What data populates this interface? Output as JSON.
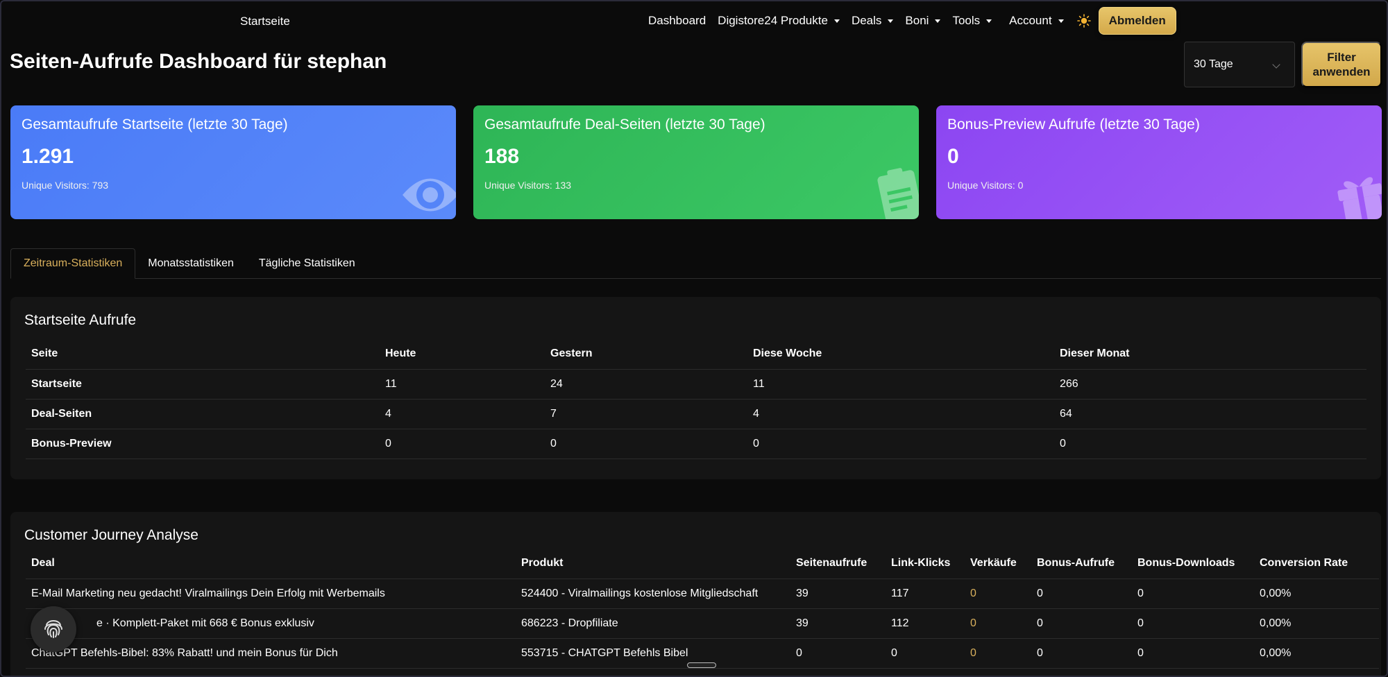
{
  "nav": {
    "brand": "Startseite",
    "items": [
      {
        "label": "Dashboard",
        "dropdown": false
      },
      {
        "label": "Digistore24 Produkte",
        "dropdown": true
      },
      {
        "label": "Deals",
        "dropdown": true
      },
      {
        "label": "Boni",
        "dropdown": true
      },
      {
        "label": "Tools",
        "dropdown": true
      }
    ],
    "account_label": "Account",
    "logout_label": "Abmelden",
    "theme_icon": "sun-icon"
  },
  "header": {
    "title": "Seiten-Aufrufe Dashboard für stephan",
    "period_selected": "30 Tage",
    "filter_label_line1": "Filter",
    "filter_label_line2": "anwenden"
  },
  "cards": [
    {
      "title": "Gesamtaufrufe Startseite (letzte 30 Tage)",
      "value": "1.291",
      "sub": "Unique Visitors: 793",
      "color": "#4a7bf7",
      "icon": "eye-icon"
    },
    {
      "title": "Gesamtaufrufe Deal-Seiten (letzte 30 Tage)",
      "value": "188",
      "sub": "Unique Visitors: 133",
      "color": "#2eb556",
      "icon": "clipboard-icon"
    },
    {
      "title": "Bonus-Preview Aufrufe (letzte 30 Tage)",
      "value": "0",
      "sub": "Unique Visitors: 0",
      "color": "#8c46f2",
      "icon": "gift-icon"
    }
  ],
  "tabs": [
    "Zeitraum-Statistiken",
    "Monatsstatistiken",
    "Tägliche Statistiken"
  ],
  "startseite": {
    "title": "Startseite Aufrufe",
    "columns": [
      "Seite",
      "Heute",
      "Gestern",
      "Diese Woche",
      "Dieser Monat"
    ],
    "rows": [
      [
        "Startseite",
        "11",
        "24",
        "11",
        "266"
      ],
      [
        "Deal-Seiten",
        "4",
        "7",
        "4",
        "64"
      ],
      [
        "Bonus-Preview",
        "0",
        "0",
        "0",
        "0"
      ]
    ]
  },
  "journey": {
    "title": "Customer Journey Analyse",
    "columns": [
      "Deal",
      "Produkt",
      "Seitenaufrufe",
      "Link-Klicks",
      "Verkäufe",
      "Bonus-Aufrufe",
      "Bonus-Downloads",
      "Conversion Rate"
    ],
    "rows": [
      [
        "E-Mail Marketing neu gedacht! Viralmailings Dein Erfolg mit Werbemails",
        "524400 - Viralmailings kostenlose Mitgliedschaft",
        "39",
        "117",
        "0",
        "0",
        "0",
        "0,00%"
      ],
      [
        "e · Komplett-Paket mit 668 € Bonus exklusiv",
        "686223 - Dropfiliate",
        "39",
        "112",
        "0",
        "0",
        "0",
        "0,00%"
      ],
      [
        "ChatGPT Befehls-Bibel: 83% Rabatt! und mein Bonus für Dich",
        "553715 - CHATGPT Befehls Bibel",
        "0",
        "0",
        "0",
        "0",
        "0",
        "0,00%"
      ]
    ]
  },
  "colors": {
    "accent_gold": "#d9b05c"
  }
}
